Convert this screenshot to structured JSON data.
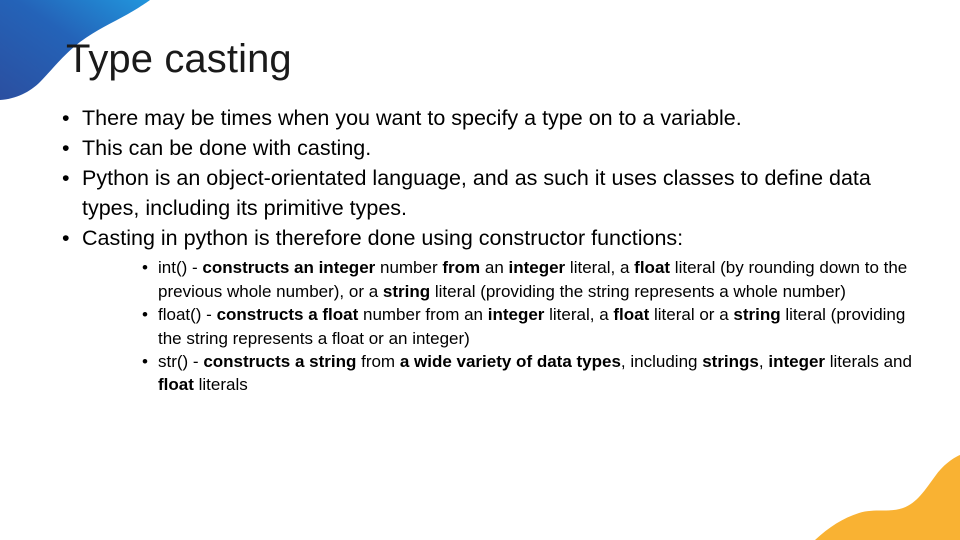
{
  "slide": {
    "title": "Type casting",
    "bullet_glyph": "•",
    "colors": {
      "blue_dark": "#2B5BA8",
      "blue_light": "#2196DD",
      "orange": "#F9B233",
      "text": "#000000",
      "title_text": "#1A1A1A",
      "background": "#FFFFFF"
    },
    "level1": [
      {
        "runs": [
          {
            "text": "There may be times when you want to specify a type on to a variable.",
            "bold": false
          }
        ]
      },
      {
        "runs": [
          {
            "text": "This can be done with casting.",
            "bold": false
          }
        ]
      },
      {
        "runs": [
          {
            "text": "Python is an object-orientated language, and as such it uses classes to define data types, including its primitive types.",
            "bold": false
          }
        ]
      },
      {
        "runs": [
          {
            "text": "Casting in python is therefore done using constructor functions:",
            "bold": false
          }
        ]
      }
    ],
    "level2": [
      {
        "runs": [
          {
            "text": "int() - ",
            "bold": false
          },
          {
            "text": "constructs an integer",
            "bold": true
          },
          {
            "text": " number ",
            "bold": false
          },
          {
            "text": "from",
            "bold": true
          },
          {
            "text": " an ",
            "bold": false
          },
          {
            "text": "integer",
            "bold": true
          },
          {
            "text": " literal, a ",
            "bold": false
          },
          {
            "text": "float",
            "bold": true
          },
          {
            "text": " literal (by rounding down to the previous whole number), or a ",
            "bold": false
          },
          {
            "text": "string",
            "bold": true
          },
          {
            "text": " literal (providing the string represents a whole number)",
            "bold": false
          }
        ]
      },
      {
        "runs": [
          {
            "text": "float() - ",
            "bold": false
          },
          {
            "text": "constructs a float",
            "bold": true
          },
          {
            "text": " number from an ",
            "bold": false
          },
          {
            "text": "integer",
            "bold": true
          },
          {
            "text": " literal, a ",
            "bold": false
          },
          {
            "text": "float",
            "bold": true
          },
          {
            "text": " literal or a ",
            "bold": false
          },
          {
            "text": "string",
            "bold": true
          },
          {
            "text": " literal (providing the string represents a float or an integer)",
            "bold": false
          }
        ]
      },
      {
        "runs": [
          {
            "text": "str() - ",
            "bold": false
          },
          {
            "text": "constructs a string",
            "bold": true
          },
          {
            "text": " from ",
            "bold": false
          },
          {
            "text": "a wide variety of data types",
            "bold": true
          },
          {
            "text": ", including ",
            "bold": false
          },
          {
            "text": "strings",
            "bold": true
          },
          {
            "text": ", ",
            "bold": false
          },
          {
            "text": "integer",
            "bold": true
          },
          {
            "text": " literals and ",
            "bold": false
          },
          {
            "text": "float",
            "bold": true
          },
          {
            "text": " literals",
            "bold": false
          }
        ]
      }
    ]
  }
}
